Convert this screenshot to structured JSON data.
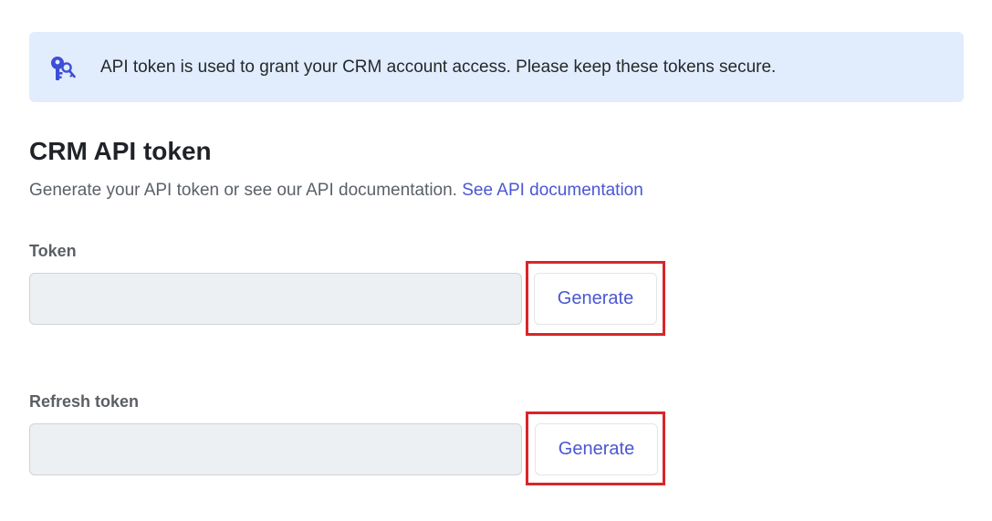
{
  "banner": {
    "icon": "key-icon",
    "message": "API token is used to grant your CRM account access. Please keep these tokens secure."
  },
  "header": {
    "title": "CRM API token",
    "subtitle": "Generate your API token or see our API documentation.",
    "doc_link": "See API documentation"
  },
  "fields": {
    "token": {
      "label": "Token",
      "value": "",
      "button_label": "Generate"
    },
    "refresh_token": {
      "label": "Refresh token",
      "value": "",
      "button_label": "Generate"
    }
  },
  "colors": {
    "accent": "#4a57d2",
    "banner_bg": "#e1edfd",
    "highlight": "#d9252b",
    "input_bg": "#edf0f2"
  }
}
